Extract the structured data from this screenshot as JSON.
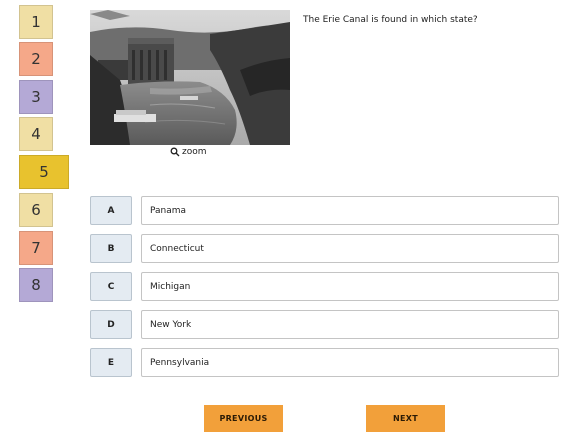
{
  "navigator": {
    "items": [
      {
        "label": "1",
        "color": "#f0dfa4"
      },
      {
        "label": "2",
        "color": "#f5a889"
      },
      {
        "label": "3",
        "color": "#b4a9d6"
      },
      {
        "label": "4",
        "color": "#f0dfa4"
      },
      {
        "label": "5",
        "color": "#e8c22e"
      },
      {
        "label": "6",
        "color": "#f0dfa4"
      },
      {
        "label": "7",
        "color": "#f5a889"
      },
      {
        "label": "8",
        "color": "#b4a9d6"
      }
    ],
    "current": "5"
  },
  "question": {
    "text": "The Erie Canal is found in which state?",
    "zoom_label": "zoom"
  },
  "answers": [
    {
      "letter": "A",
      "text": "Panama"
    },
    {
      "letter": "B",
      "text": "Connecticut"
    },
    {
      "letter": "C",
      "text": "Michigan"
    },
    {
      "letter": "D",
      "text": "New York"
    },
    {
      "letter": "E",
      "text": "Pennsylvania"
    }
  ],
  "buttons": {
    "previous": "PREVIOUS",
    "next": "NEXT"
  }
}
